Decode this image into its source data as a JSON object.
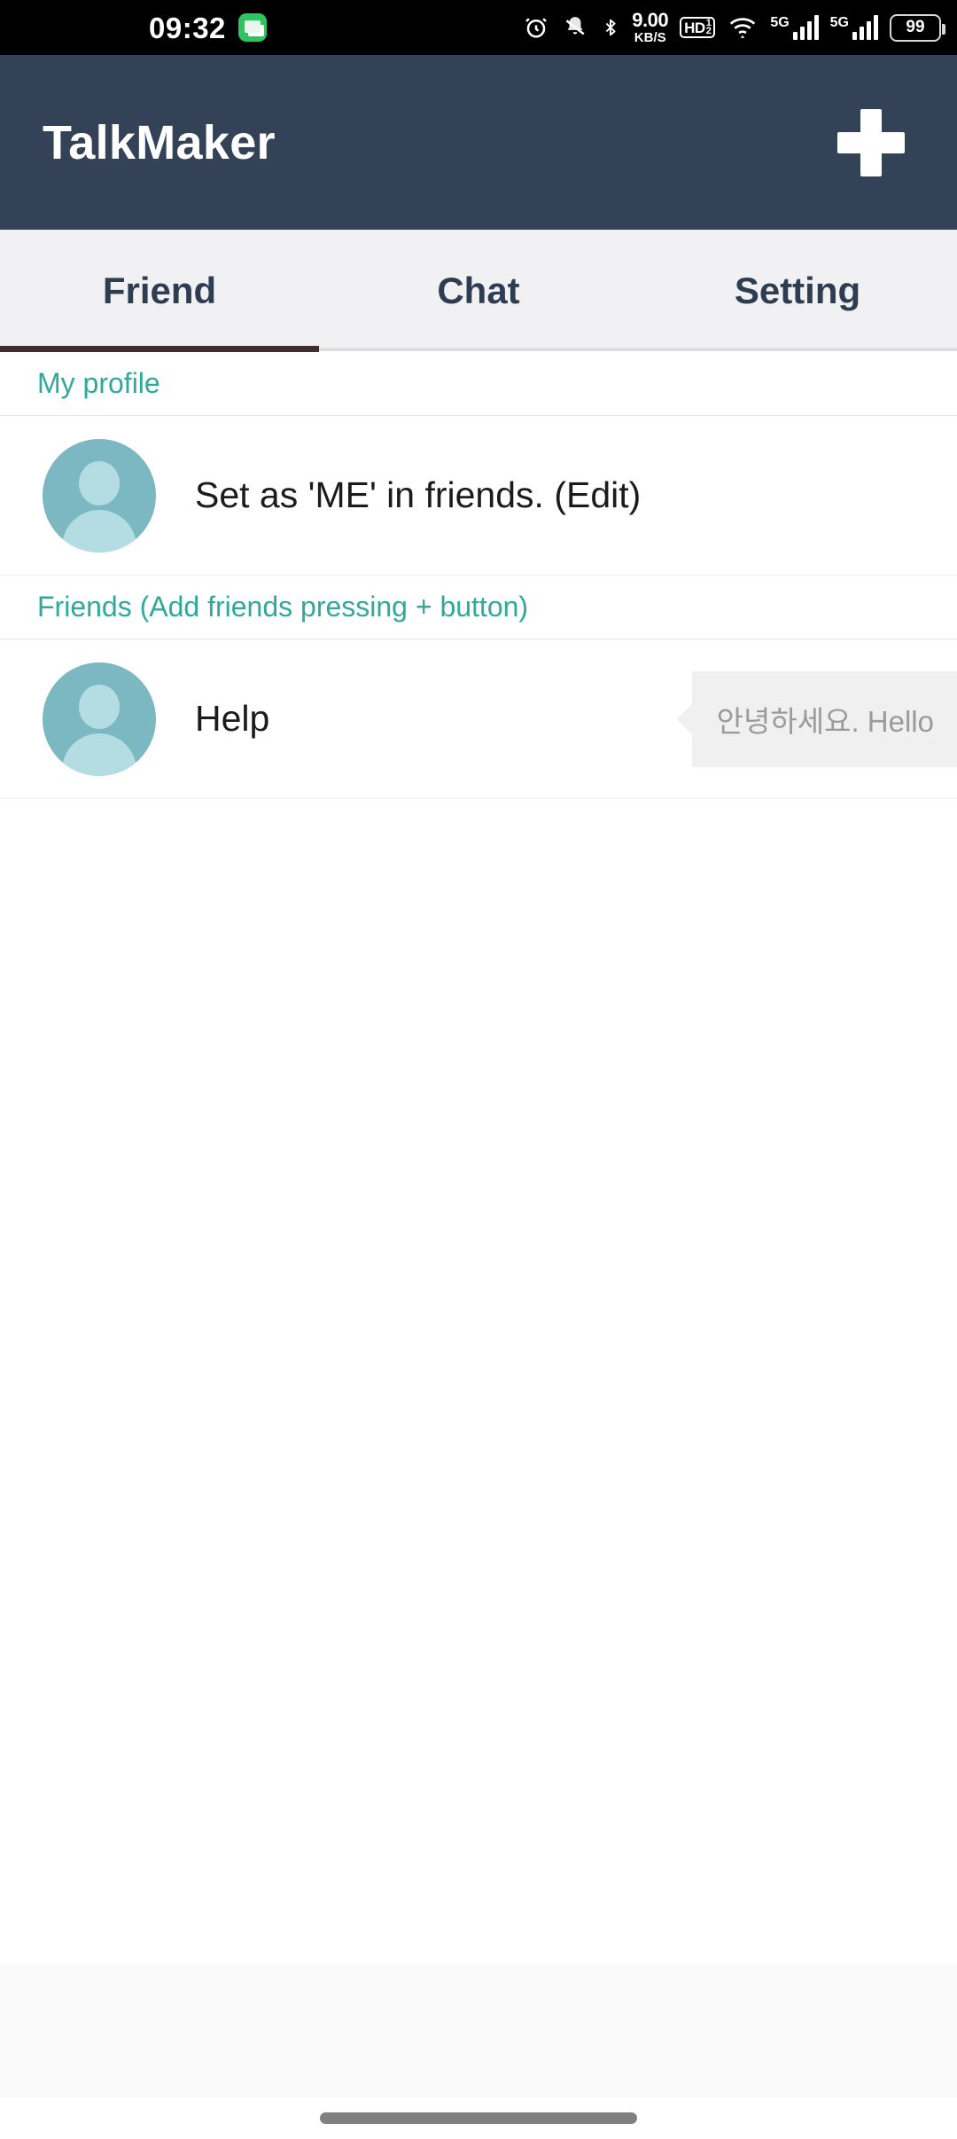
{
  "status_bar": {
    "time": "09:32",
    "message_icon": "message-icon",
    "alarm_icon": "alarm-clock-icon",
    "mute_icon": "bell-mute-icon",
    "bluetooth_icon": "bluetooth-icon",
    "net_speed_value": "9.00",
    "net_speed_unit": "KB/S",
    "hd_label": "HD",
    "hd_sup": "1",
    "hd_sub": "2",
    "wifi_icon": "wifi-icon",
    "sim1_label": "5G",
    "sim2_label": "5G",
    "battery_percent": "99"
  },
  "app_bar": {
    "title": "TalkMaker",
    "add_button_label": "+",
    "background_color": "#334256"
  },
  "tabs": {
    "items": [
      {
        "label": "Friend",
        "active": true
      },
      {
        "label": "Chat",
        "active": false
      },
      {
        "label": "Setting",
        "active": false
      }
    ],
    "indicator_color": "#3e2f2d",
    "text_color": "#2e3e52",
    "background_color": "#f1f1f3"
  },
  "sections": [
    {
      "header": "My profile",
      "rows": [
        {
          "name": "Set as 'ME' in friends. (Edit)",
          "avatar": "person-avatar-icon",
          "bubble": null
        }
      ]
    },
    {
      "header": "Friends (Add friends pressing + button)",
      "rows": [
        {
          "name": "Help",
          "avatar": "person-avatar-icon",
          "bubble": "안녕하세요. Hello"
        }
      ]
    }
  ],
  "accent_colors": {
    "section_header_teal": "#30a99a",
    "avatar_teal": "#7cb8c2",
    "avatar_silhouette": "#b3dde3",
    "bubble_gray": "#f0f0f0",
    "bubble_text_gray": "#9a9a9a"
  },
  "bottom": {
    "ad_band_color": "#f9f9fa",
    "nav_pill": "gesture-navigation-pill"
  }
}
